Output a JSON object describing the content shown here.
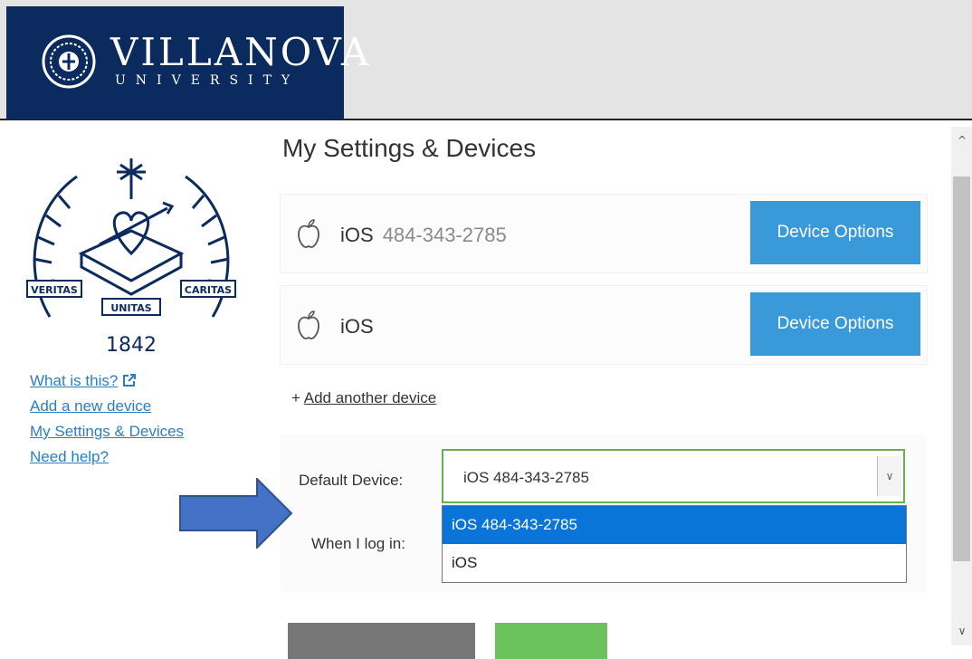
{
  "logo": {
    "wordmark": "VILLANOVA",
    "sub": "UNIVERSITY",
    "seal_icon": "villanova-seal-icon"
  },
  "sidebar": {
    "seal": {
      "mottos": [
        "VERITAS",
        "UNITAS",
        "CARITAS"
      ],
      "year": "1842"
    },
    "links": [
      {
        "label": "What is this?",
        "icon": "external-link-icon"
      },
      {
        "label": "Add a new device"
      },
      {
        "label": "My Settings & Devices"
      },
      {
        "label": "Need help?"
      }
    ]
  },
  "main": {
    "title": "My Settings & Devices",
    "devices": [
      {
        "icon": "apple-icon",
        "name": "iOS",
        "phone": "484-343-2785",
        "button": "Device Options"
      },
      {
        "icon": "apple-icon",
        "name": "iOS",
        "phone": "",
        "button": "Device Options"
      }
    ],
    "add_prefix": "+",
    "add_link": "Add another device",
    "settings": {
      "default_label": "Default Device:",
      "login_label": "When I log in:",
      "select_value": "iOS 484-343-2785",
      "options": [
        "iOS 484-343-2785",
        "iOS"
      ]
    }
  },
  "colors": {
    "brand": "#0b2b5e",
    "button": "#3a9ad9",
    "link": "#2a7fc0",
    "focus": "#62b44a",
    "selected": "#0a74d8",
    "arrow": "#4472c4"
  }
}
